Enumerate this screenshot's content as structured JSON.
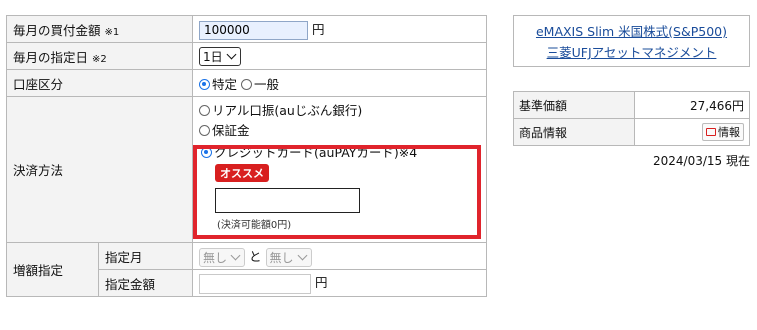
{
  "form": {
    "monthly_amount": {
      "label": "毎月の買付金額",
      "note": "※1",
      "value": "100000",
      "unit": "円"
    },
    "monthly_day": {
      "label": "毎月の指定日",
      "note": "※2",
      "value": "1日"
    },
    "account_type": {
      "label": "口座区分",
      "options": [
        "特定",
        "一般"
      ],
      "selected": "特定"
    },
    "payment": {
      "label": "決済方法",
      "options": [
        "リアル口振(auじぶん銀行)",
        "保証金",
        "クレジットカード(auPAYカード)※4"
      ],
      "selected": "クレジットカード(auPAYカード)※4",
      "badge": "オススメ",
      "card_input_value": "",
      "note": "(決済可能額0円)"
    },
    "increase": {
      "label": "増額指定",
      "month_label": "指定月",
      "month_from": "無し",
      "month_sep": "と",
      "month_to": "無し",
      "amount_label": "指定金額",
      "amount_value": "",
      "amount_unit": "円"
    }
  },
  "fund": {
    "name": "eMAXIS Slim 米国株式(S&P500)",
    "company": "三菱UFJアセットマネジメント",
    "nav_label": "基準価額",
    "nav_value": "27,466円",
    "info_label": "商品情報",
    "info_button": "情報",
    "date": "2024/03/15 現在"
  },
  "colors": {
    "highlight": "#e0242c",
    "badge": "#d81f1f",
    "link": "#1a4c9a"
  }
}
